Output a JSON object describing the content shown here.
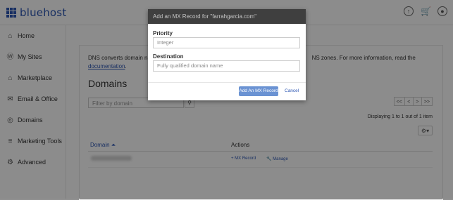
{
  "brand": {
    "name": "bluehost"
  },
  "sidebar": {
    "items": [
      {
        "label": "Home",
        "icon": "home-icon"
      },
      {
        "label": "My Sites",
        "icon": "wordpress-icon"
      },
      {
        "label": "Marketplace",
        "icon": "tag-icon"
      },
      {
        "label": "Email & Office",
        "icon": "mail-icon"
      },
      {
        "label": "Domains",
        "icon": "globe-icon"
      },
      {
        "label": "Marketing Tools",
        "icon": "stack-icon"
      },
      {
        "label": "Advanced",
        "icon": "gear-icon"
      }
    ]
  },
  "main": {
    "info_text_start": "DNS converts domain nam",
    "info_text_end": "NS zones. For more information, read the",
    "info_link": "documentation",
    "info_period": ".",
    "heading": "Domains",
    "filter_placeholder": "Filter by domain",
    "pager": [
      "<<",
      "<",
      ">",
      ">>"
    ],
    "displaying": "Displaying 1 to 1 out of 1 item",
    "table": {
      "col_domain": "Domain",
      "col_actions": "Actions",
      "rows": [
        {
          "mx_action": "+ MX Record",
          "manage_action": "Manage"
        }
      ]
    }
  },
  "modal": {
    "title": "Add an MX Record for \"farrahgarcia.com\"",
    "priority_label": "Priority",
    "priority_placeholder": "Integer",
    "destination_label": "Destination",
    "destination_placeholder": "Fully qualified domain name",
    "add_button": "Add An MX Record",
    "cancel_button": "Cancel"
  },
  "colors": {
    "brand": "#2d56b3",
    "modal_header": "#3f3f3f",
    "primary_button": "#6b93d3"
  }
}
